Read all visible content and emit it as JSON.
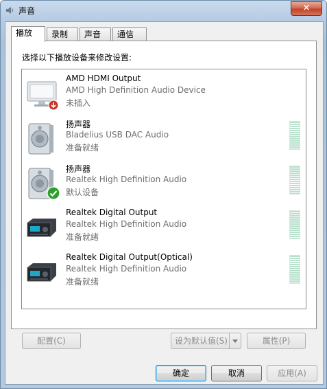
{
  "window": {
    "title": "声音",
    "close_glyph": "✕"
  },
  "tabs": [
    "播放",
    "录制",
    "声音",
    "通信"
  ],
  "instruction": "选择以下播放设备来修改设置:",
  "devices": [
    {
      "name": "AMD HDMI Output",
      "desc": "AMD High Definition Audio Device",
      "status": "未插入",
      "icon": "monitor-icon",
      "badge": "unplugged-arrow-icon"
    },
    {
      "name": "扬声器",
      "desc": "Bladelius USB DAC Audio",
      "status": "准备就绪",
      "icon": "speaker-icon",
      "badge": ""
    },
    {
      "name": "扬声器",
      "desc": "Realtek High Definition Audio",
      "status": "默认设备",
      "icon": "speaker-icon",
      "badge": "default-check-icon"
    },
    {
      "name": "Realtek Digital Output",
      "desc": "Realtek High Definition Audio",
      "status": "准备就绪",
      "icon": "receiver-icon",
      "badge": ""
    },
    {
      "name": "Realtek Digital Output(Optical)",
      "desc": "Realtek High Definition Audio",
      "status": "准备就绪",
      "icon": "receiver-icon",
      "badge": ""
    }
  ],
  "buttons": {
    "configure": "配置(C)",
    "set_default": "设为默认值(S)",
    "properties": "属性(P)",
    "ok": "确定",
    "cancel": "取消",
    "apply": "应用(A)"
  },
  "colors": {
    "meter": "#b8e0cc",
    "close": "#c0432a",
    "check": "#2e9e2e"
  }
}
